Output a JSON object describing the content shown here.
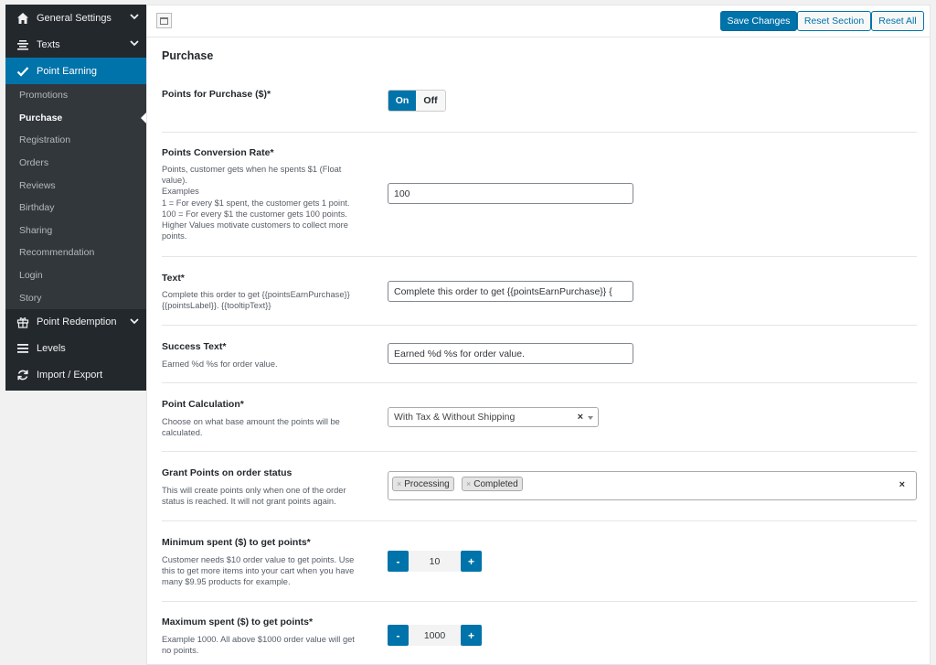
{
  "sidebar": {
    "general_settings": "General Settings",
    "texts": "Texts",
    "point_earning": "Point Earning",
    "sub_items": [
      "Promotions",
      "Purchase",
      "Registration",
      "Orders",
      "Reviews",
      "Birthday",
      "Sharing",
      "Recommendation",
      "Login",
      "Story"
    ],
    "point_redemption": "Point Redemption",
    "levels": "Levels",
    "import_export": "Import / Export"
  },
  "toolbar": {
    "save_label": "Save Changes",
    "reset_section_label": "Reset Section",
    "reset_all_label": "Reset All"
  },
  "section": {
    "title": "Purchase"
  },
  "fields": {
    "points_for_purchase": {
      "label": "Points for Purchase ($)*",
      "on": "On",
      "off": "Off"
    },
    "conversion_rate": {
      "label": "Points Conversion Rate*",
      "desc_lines": [
        "Points, customer gets when he spents $1 (Float",
        "value).",
        "Examples",
        "1 = For every $1 spent, the customer gets 1 point.",
        "100 = For every $1 the customer gets 100 points.",
        "Higher Values motivate customers to collect more",
        "points."
      ],
      "value": "100"
    },
    "text": {
      "label": "Text*",
      "desc_lines": [
        "Complete this order to get {{pointsEarnPurchase}}",
        "{{pointsLabel}}. {{tooltipText}}"
      ],
      "value": "Complete this order to get {{pointsEarnPurchase}} {"
    },
    "success_text": {
      "label": "Success Text*",
      "desc": "Earned %d %s for order value.",
      "value": "Earned %d %s for order value."
    },
    "point_calculation": {
      "label": "Point Calculation*",
      "desc_lines": [
        "Choose on what base amount the points will be",
        "calculated."
      ],
      "value": "With Tax & Without Shipping",
      "clear": "×"
    },
    "grant_status": {
      "label": "Grant Points on order status",
      "desc_lines": [
        "This will create points only when one of the order",
        "status is reached. It will not grant points again."
      ],
      "tags": [
        "Processing",
        "Completed"
      ],
      "tag_remove": "×",
      "clear": "×"
    },
    "min_spent": {
      "label": "Minimum spent ($) to get points*",
      "desc_lines": [
        "Customer needs $10 order value to get points. Use",
        "this to get more items into your cart when you have",
        "many $9.95 products for example."
      ],
      "value": "10",
      "minus": "-",
      "plus": "+"
    },
    "max_spent": {
      "label": "Maximum spent ($) to get points*",
      "desc_lines": [
        "Example 1000. All above $1000 order value will get",
        "no points."
      ],
      "value": "1000",
      "minus": "-",
      "plus": "+"
    }
  },
  "colors": {
    "accent": "#0073aa",
    "sidebar_bg": "#23282d",
    "submenu_bg": "#32373c"
  }
}
